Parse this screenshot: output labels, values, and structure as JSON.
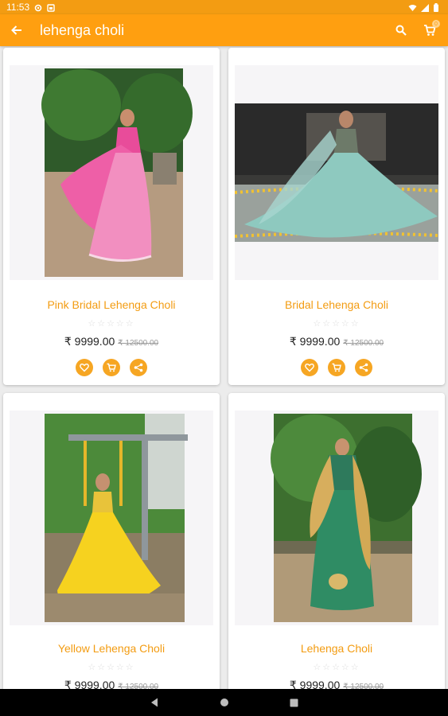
{
  "status_bar": {
    "time": "11:53",
    "icons": [
      "settings-icon",
      "sim-icon",
      "wifi-icon",
      "signal-icon",
      "battery-icon"
    ]
  },
  "app_bar": {
    "title": "lehenga choli",
    "cart_count": "0",
    "icons": [
      "back-arrow-icon",
      "search-icon",
      "cart-icon"
    ]
  },
  "products": [
    {
      "name": "Pink Bridal Lehenga Choli",
      "rating": "☆☆☆☆☆",
      "price": "₹ 9999.00",
      "old_price": "₹ 12500.00",
      "actions": [
        "heart-icon",
        "cart-icon",
        "share-icon"
      ]
    },
    {
      "name": "Bridal Lehenga Choli",
      "rating": "☆☆☆☆☆",
      "price": "₹ 9999.00",
      "old_price": "₹ 12500.00",
      "actions": [
        "heart-icon",
        "cart-icon",
        "share-icon"
      ]
    },
    {
      "name": "Yellow Lehenga Choli",
      "rating": "☆☆☆☆☆",
      "price": "₹ 9999.00",
      "old_price": "₹ 12500.00"
    },
    {
      "name": "Lehenga Choli",
      "rating": "☆☆☆☆☆",
      "price": "₹ 9999.00",
      "old_price": "₹ 12500.00"
    }
  ],
  "nav_bar": {
    "icons": [
      "back-triangle-icon",
      "home-circle-icon",
      "recents-square-icon"
    ]
  },
  "colors": {
    "accent": "#ff9f10",
    "status_bar": "#f39c12",
    "product_name": "#f39c12",
    "action_button": "#f6a623"
  }
}
